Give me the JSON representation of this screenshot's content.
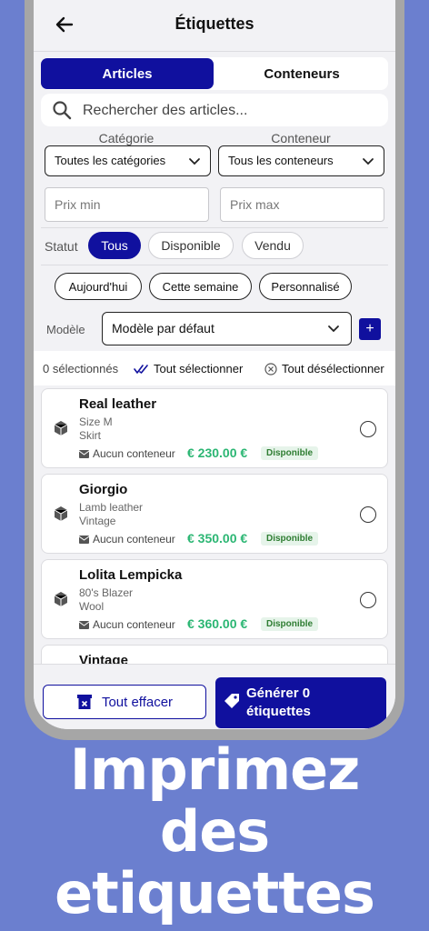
{
  "header": {
    "title": "Étiquettes"
  },
  "tabs": [
    {
      "label": "Articles",
      "active": true
    },
    {
      "label": "Conteneurs",
      "active": false
    }
  ],
  "search": {
    "placeholder": "Rechercher des articles..."
  },
  "filters": {
    "categorie_label": "Catégorie",
    "categorie_value": "Toutes les catégories",
    "conteneur_label": "Conteneur",
    "conteneur_value": "Tous les conteneurs",
    "prix_min_placeholder": "Prix min",
    "prix_max_placeholder": "Prix max",
    "statut_label": "Statut",
    "statut_options": [
      "Tous",
      "Disponible",
      "Vendu"
    ],
    "date_options": [
      "Aujourd'hui",
      "Cette semaine",
      "Personnalisé"
    ]
  },
  "modele": {
    "label": "Modèle",
    "value": "Modèle par défaut",
    "add": "+"
  },
  "selection": {
    "count": "0 sélectionnés",
    "select_all": "Tout sélectionner",
    "deselect_all": "Tout désélectionner"
  },
  "items": [
    {
      "name": "Real leather",
      "line1": "Size M",
      "line2": "Skirt",
      "container": "Aucun conteneur",
      "price": "€ 230.00 €",
      "status": "Disponible"
    },
    {
      "name": "Giorgio",
      "line1": "Lamb leather",
      "line2": "Vintage",
      "container": "Aucun conteneur",
      "price": "€ 350.00 €",
      "status": "Disponible"
    },
    {
      "name": "Lolita Lempicka",
      "line1": "80's Blazer",
      "line2": "Wool",
      "container": "Aucun conteneur",
      "price": "€ 360.00 €",
      "status": "Disponible"
    },
    {
      "name": "Vintage"
    }
  ],
  "actions": {
    "clear": "Tout effacer",
    "generate_line1": "Générer 0",
    "generate_line2": "étiquettes"
  },
  "promo": {
    "line1": "Imprimez",
    "line2": "des",
    "line3": "etiquettes"
  },
  "colors": {
    "primary": "#10109e",
    "background": "#6b7fcf",
    "price": "#2bb673",
    "badge": "#e6f4ea"
  }
}
